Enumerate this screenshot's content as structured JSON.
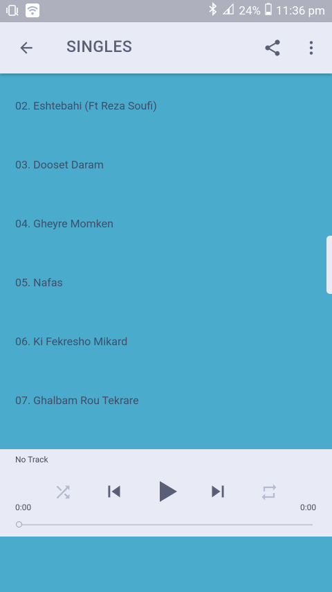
{
  "status_bar": {
    "battery": "24%",
    "time": "11:36 pm"
  },
  "app_bar": {
    "title": "SINGLES",
    "icons": {
      "back": "arrow-back-icon",
      "share": "share-icon",
      "more": "more-vert-icon"
    }
  },
  "tracks": [
    {
      "label": "02. Eshtebahi (Ft Reza Soufi)"
    },
    {
      "label": "03. Dooset Daram"
    },
    {
      "label": "04. Gheyre Momken"
    },
    {
      "label": "05. Nafas"
    },
    {
      "label": "06. Ki Fekresho Mikard"
    },
    {
      "label": "07. Ghalbam Rou Tekrare"
    }
  ],
  "player": {
    "track_status": "No Track",
    "elapsed": "0:00",
    "duration": "0:00",
    "progress": 0,
    "icons": {
      "shuffle": "shuffle-icon",
      "previous": "skip-previous-icon",
      "play": "play-icon",
      "next": "skip-next-icon",
      "repeat": "repeat-icon"
    }
  },
  "colors": {
    "list_background": "#4aabcd",
    "bar_background": "#e8eaf6",
    "status_bar": "#aeb1bd",
    "text_primary": "#3f4f6a",
    "icon_active": "#5b5f76",
    "icon_disabled": "#b6bbd0"
  }
}
